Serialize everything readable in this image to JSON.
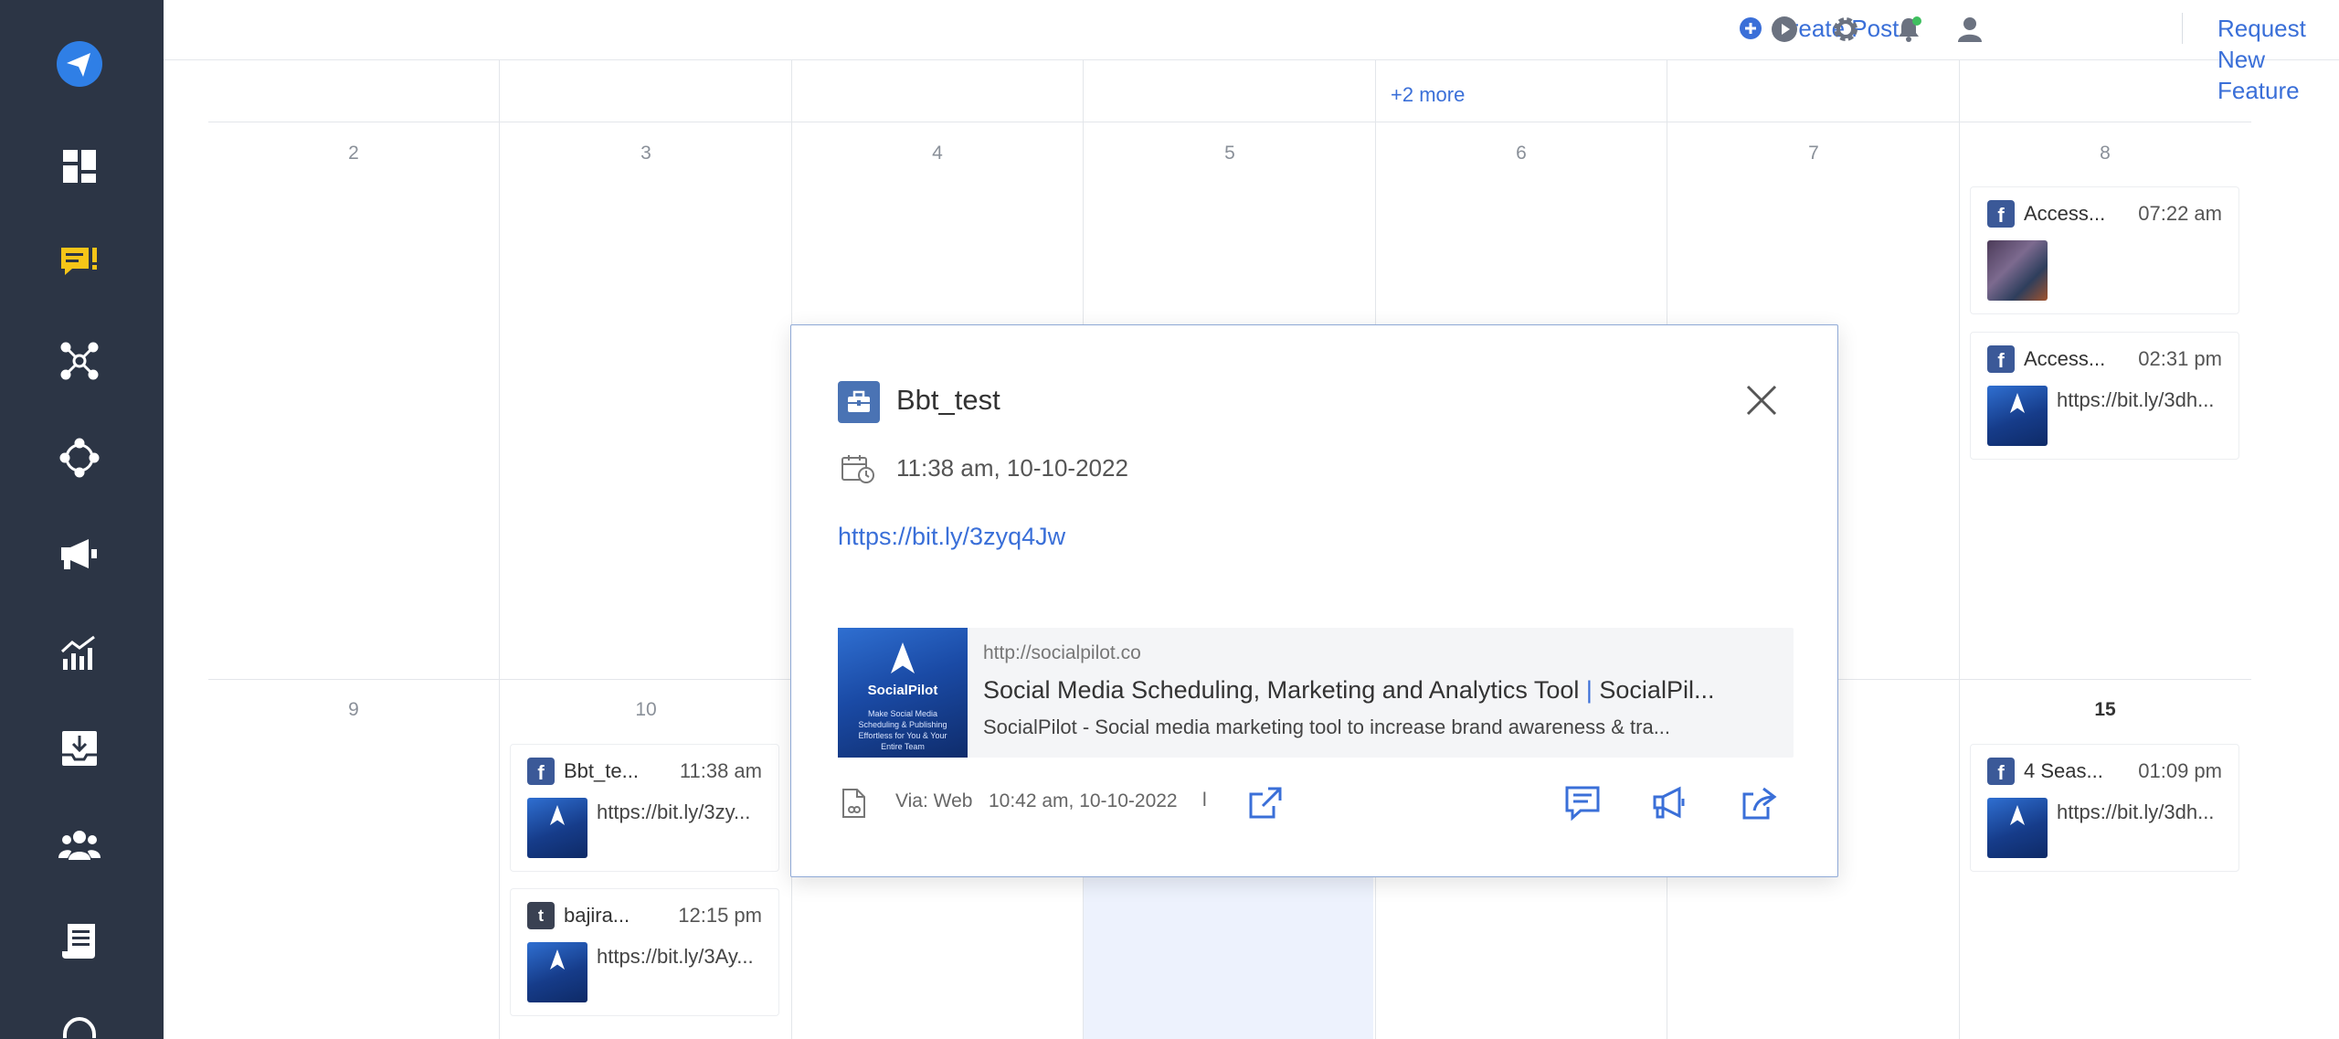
{
  "topbar": {
    "create_post": "Create Post",
    "request_feature": "Request New Feature"
  },
  "sidebar": {
    "items": [
      {
        "icon": "send-logo-icon"
      },
      {
        "icon": "dashboard-icon"
      },
      {
        "icon": "feedback-icon",
        "color": "#f5c518"
      },
      {
        "icon": "network-icon"
      },
      {
        "icon": "connect-icon"
      },
      {
        "icon": "megaphone-icon"
      },
      {
        "icon": "analytics-icon"
      },
      {
        "icon": "inbox-download-icon"
      },
      {
        "icon": "team-icon"
      },
      {
        "icon": "content-icon"
      },
      {
        "icon": "support-icon"
      }
    ]
  },
  "calendar": {
    "more_link": "+2 more",
    "week1_days": [
      "2",
      "3",
      "4",
      "5",
      "6",
      "7",
      "8"
    ],
    "week2_days": [
      "9",
      "10",
      "15"
    ],
    "events": {
      "e1": {
        "name": "Access...",
        "time": "07:22 am"
      },
      "e2": {
        "name": "Access...",
        "time": "02:31 pm",
        "link": "https://bit.ly/3dh..."
      },
      "e3": {
        "name": "Bbt_te...",
        "time": "11:38 am",
        "link": "https://bit.ly/3zy..."
      },
      "e4": {
        "name": "bajira...",
        "time": "12:15 pm",
        "link": "https://bit.ly/3Ay..."
      },
      "e5": {
        "name": "4 Seas...",
        "time": "01:09 pm",
        "link": "https://bit.ly/3dh..."
      }
    }
  },
  "modal": {
    "account_name": "Bbt_test",
    "datetime": "11:38 am, 10-10-2022",
    "link": "https://bit.ly/3zyq4Jw",
    "preview": {
      "image_brand": "SocialPilot",
      "image_tagline": "Make Social Media Scheduling & Publishing Effortless for You & Your Entire Team",
      "domain": "http://socialpilot.co",
      "title_part1": "Social Media Scheduling, Marketing and Analytics Tool ",
      "title_pipe": "|",
      "title_part2": " SocialPil...",
      "description": "SocialPilot - Social media marketing tool to increase brand awareness & tra..."
    },
    "footer": {
      "via": "Via: Web",
      "created": "10:42 am, 10-10-2022",
      "separator": "l"
    }
  },
  "colors": {
    "sidebar_bg": "#2c3545",
    "accent": "#3a6fd8",
    "facebook": "#3b5998",
    "highlight": "#edf2fd"
  }
}
